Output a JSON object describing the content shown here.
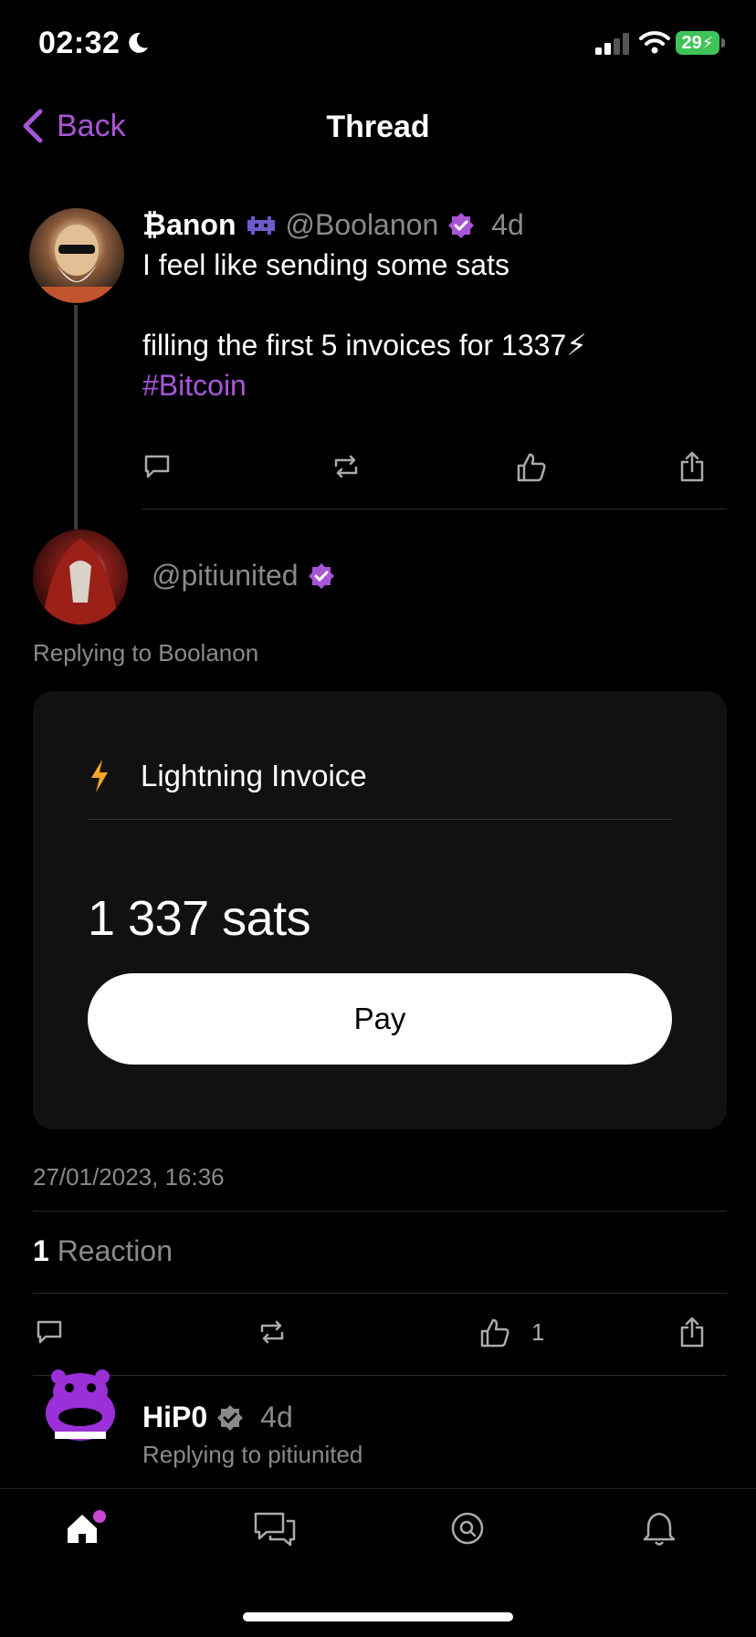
{
  "status_bar": {
    "time": "02:32",
    "battery": "29"
  },
  "header": {
    "back_label": "Back",
    "title": "Thread"
  },
  "post": {
    "display_name": "₿anon",
    "handle": "@Boolanon",
    "age": "4d",
    "line1": "I feel like sending some sats",
    "line2": "filling the first 5 invoices for 1337⚡",
    "hashtag": "#Bitcoin"
  },
  "reply": {
    "handle": "@pitiunited",
    "replying_to": "Replying to Boolanon",
    "invoice": {
      "title": "Lightning Invoice",
      "amount": "1 337 sats",
      "pay_label": "Pay"
    },
    "timestamp": "27/01/2023, 16:36",
    "reaction_count": "1",
    "reaction_label": "Reaction",
    "like_count": "1"
  },
  "next_reply": {
    "display_name": "HiP0",
    "age": "4d",
    "replying_to": "Replying to pitiunited"
  },
  "colors": {
    "accent": "#a855d6",
    "lightning": "#f5a623",
    "background": "#000000"
  },
  "icons": [
    "reply-icon",
    "repost-icon",
    "like-icon",
    "share-icon",
    "home-icon",
    "messages-icon",
    "search-icon",
    "bell-icon"
  ]
}
